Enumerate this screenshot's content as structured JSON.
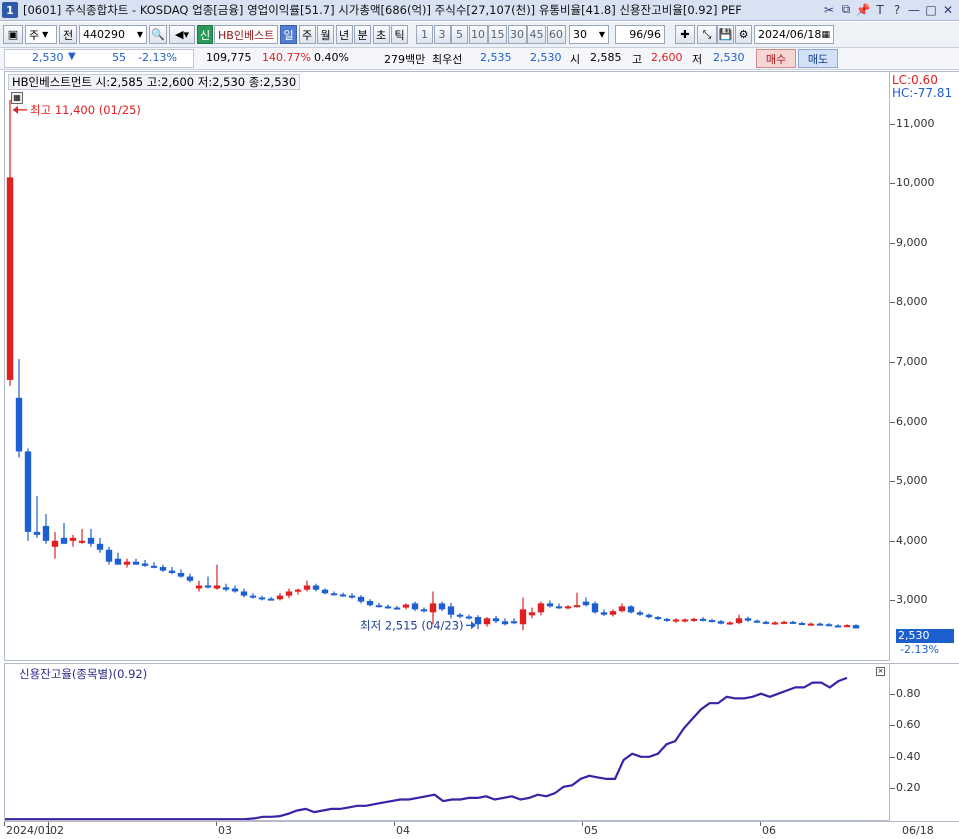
{
  "window": {
    "number": "1",
    "title": "[0601] 주식종합차트 - KOSDAQ 업종[금융] 영업이익률[51.7] 시가총액[686(억)] 주식수[27,107(천)] 유통비율[41.8] 신용잔고비율[0.92] PEF"
  },
  "toolbar": {
    "period_select": "주",
    "all_label": "전",
    "code": "440290",
    "credit_badge": "신",
    "stock_name": "HB인베스트",
    "period_tabs": [
      "일",
      "주",
      "월",
      "년",
      "분",
      "초",
      "틱"
    ],
    "active_tab": "일",
    "minute_options": [
      "1",
      "3",
      "5",
      "10",
      "15",
      "30",
      "45",
      "60"
    ],
    "minute_value": "30",
    "count": "96/96",
    "date": "2024/06/18"
  },
  "quote": {
    "price": "2,530",
    "direction": "▼",
    "change": "55",
    "change_pct": "-2.13%",
    "volume": "109,775",
    "volume_ratio": "140.77%",
    "turnover": "0.40%",
    "amount": "279백만",
    "best_label": "최우선",
    "best_ask": "2,535",
    "best_bid": "2,530",
    "open_label": "시",
    "open": "2,585",
    "high_label": "고",
    "high": "2,600",
    "low_label": "저",
    "low": "2,530",
    "buy_button": "매수",
    "sell_button": "매도"
  },
  "main_chart": {
    "legend": "HB인베스트먼트 시:2,585 고:2,600 저:2,530 종:2,530",
    "lc_label": "LC:0.60",
    "hc_label": "HC:-77.81",
    "high_annotation": "최고 11,400 (01/25)",
    "low_annotation": "최저 2,515 (04/23)",
    "current_price_tag": "2,530",
    "current_change_tag": "-2.13%",
    "y_ticks": [
      "11,000",
      "10,000",
      "9,000",
      "8,000",
      "7,000",
      "6,000",
      "5,000",
      "4,000",
      "3,000"
    ]
  },
  "sub_chart": {
    "legend": "신용잔고율(종목별)(0.92)",
    "y_ticks": [
      "0.80",
      "0.60",
      "0.40",
      "0.20"
    ]
  },
  "date_axis": {
    "labels": [
      "2024/01",
      "02",
      "03",
      "04",
      "05",
      "06"
    ],
    "end_label": "06/18"
  },
  "colors": {
    "up": "#e02020",
    "down": "#1e5fd0",
    "line": "#3a22a8",
    "active_tab": "#4f7ed1"
  },
  "chart_data": [
    {
      "type": "candlestick",
      "ylim": [
        2000,
        11700
      ],
      "candles": [
        {
          "o": 6700,
          "h": 11400,
          "l": 6600,
          "c": 10100
        },
        {
          "o": 6400,
          "h": 7050,
          "l": 5400,
          "c": 5500
        },
        {
          "o": 5500,
          "h": 5550,
          "l": 4000,
          "c": 4150
        },
        {
          "o": 4150,
          "h": 4750,
          "l": 4050,
          "c": 4100
        },
        {
          "o": 4250,
          "h": 4450,
          "l": 3950,
          "c": 4000
        },
        {
          "o": 3900,
          "h": 4150,
          "l": 3700,
          "c": 4000
        },
        {
          "o": 4050,
          "h": 4300,
          "l": 3950,
          "c": 3950
        },
        {
          "o": 4000,
          "h": 4100,
          "l": 3900,
          "c": 4050
        },
        {
          "o": 4000,
          "h": 4200,
          "l": 3950,
          "c": 4000
        },
        {
          "o": 4050,
          "h": 4200,
          "l": 3900,
          "c": 3950
        },
        {
          "o": 3950,
          "h": 4050,
          "l": 3800,
          "c": 3850
        },
        {
          "o": 3850,
          "h": 3900,
          "l": 3600,
          "c": 3650
        },
        {
          "o": 3700,
          "h": 3800,
          "l": 3600,
          "c": 3600
        },
        {
          "o": 3600,
          "h": 3700,
          "l": 3550,
          "c": 3650
        },
        {
          "o": 3650,
          "h": 3700,
          "l": 3600,
          "c": 3600
        },
        {
          "o": 3620,
          "h": 3680,
          "l": 3560,
          "c": 3580
        },
        {
          "o": 3580,
          "h": 3640,
          "l": 3540,
          "c": 3560
        },
        {
          "o": 3560,
          "h": 3600,
          "l": 3480,
          "c": 3500
        },
        {
          "o": 3500,
          "h": 3560,
          "l": 3440,
          "c": 3460
        },
        {
          "o": 3460,
          "h": 3520,
          "l": 3380,
          "c": 3400
        },
        {
          "o": 3400,
          "h": 3450,
          "l": 3300,
          "c": 3330
        },
        {
          "o": 3200,
          "h": 3330,
          "l": 3150,
          "c": 3250
        },
        {
          "o": 3250,
          "h": 3400,
          "l": 3200,
          "c": 3220
        },
        {
          "o": 3200,
          "h": 3600,
          "l": 3180,
          "c": 3250
        },
        {
          "o": 3220,
          "h": 3280,
          "l": 3150,
          "c": 3180
        },
        {
          "o": 3200,
          "h": 3250,
          "l": 3130,
          "c": 3150
        },
        {
          "o": 3150,
          "h": 3200,
          "l": 3050,
          "c": 3080
        },
        {
          "o": 3080,
          "h": 3120,
          "l": 3030,
          "c": 3050
        },
        {
          "o": 3050,
          "h": 3080,
          "l": 3000,
          "c": 3020
        },
        {
          "o": 3030,
          "h": 3060,
          "l": 3000,
          "c": 3010
        },
        {
          "o": 3020,
          "h": 3120,
          "l": 3000,
          "c": 3080
        },
        {
          "o": 3080,
          "h": 3200,
          "l": 3040,
          "c": 3150
        },
        {
          "o": 3150,
          "h": 3200,
          "l": 3100,
          "c": 3180
        },
        {
          "o": 3180,
          "h": 3330,
          "l": 3150,
          "c": 3250
        },
        {
          "o": 3250,
          "h": 3280,
          "l": 3150,
          "c": 3180
        },
        {
          "o": 3180,
          "h": 3200,
          "l": 3100,
          "c": 3120
        },
        {
          "o": 3120,
          "h": 3150,
          "l": 3080,
          "c": 3100
        },
        {
          "o": 3100,
          "h": 3130,
          "l": 3060,
          "c": 3080
        },
        {
          "o": 3080,
          "h": 3120,
          "l": 3030,
          "c": 3050
        },
        {
          "o": 3060,
          "h": 3090,
          "l": 2950,
          "c": 2980
        },
        {
          "o": 2990,
          "h": 3020,
          "l": 2900,
          "c": 2920
        },
        {
          "o": 2920,
          "h": 2960,
          "l": 2880,
          "c": 2900
        },
        {
          "o": 2900,
          "h": 2930,
          "l": 2860,
          "c": 2880
        },
        {
          "o": 2880,
          "h": 2910,
          "l": 2850,
          "c": 2870
        },
        {
          "o": 2880,
          "h": 2950,
          "l": 2850,
          "c": 2930
        },
        {
          "o": 2950,
          "h": 2980,
          "l": 2820,
          "c": 2850
        },
        {
          "o": 2850,
          "h": 2880,
          "l": 2800,
          "c": 2820
        },
        {
          "o": 2800,
          "h": 3150,
          "l": 2600,
          "c": 2950
        },
        {
          "o": 2950,
          "h": 2980,
          "l": 2820,
          "c": 2850
        },
        {
          "o": 2900,
          "h": 2960,
          "l": 2700,
          "c": 2760
        },
        {
          "o": 2760,
          "h": 2790,
          "l": 2700,
          "c": 2730
        },
        {
          "o": 2730,
          "h": 2760,
          "l": 2680,
          "c": 2700
        },
        {
          "o": 2720,
          "h": 2750,
          "l": 2515,
          "c": 2600
        },
        {
          "o": 2600,
          "h": 2720,
          "l": 2560,
          "c": 2700
        },
        {
          "o": 2700,
          "h": 2740,
          "l": 2620,
          "c": 2650
        },
        {
          "o": 2650,
          "h": 2700,
          "l": 2580,
          "c": 2600
        },
        {
          "o": 2650,
          "h": 2700,
          "l": 2600,
          "c": 2620
        },
        {
          "o": 2600,
          "h": 3050,
          "l": 2500,
          "c": 2850
        },
        {
          "o": 2750,
          "h": 2880,
          "l": 2700,
          "c": 2800
        },
        {
          "o": 2800,
          "h": 2980,
          "l": 2750,
          "c": 2950
        },
        {
          "o": 2950,
          "h": 3000,
          "l": 2880,
          "c": 2900
        },
        {
          "o": 2900,
          "h": 2950,
          "l": 2860,
          "c": 2880
        },
        {
          "o": 2880,
          "h": 2920,
          "l": 2850,
          "c": 2900
        },
        {
          "o": 2900,
          "h": 3130,
          "l": 2880,
          "c": 2920
        },
        {
          "o": 2980,
          "h": 3050,
          "l": 2900,
          "c": 2920
        },
        {
          "o": 2950,
          "h": 2980,
          "l": 2780,
          "c": 2800
        },
        {
          "o": 2800,
          "h": 2850,
          "l": 2740,
          "c": 2760
        },
        {
          "o": 2760,
          "h": 2850,
          "l": 2730,
          "c": 2820
        },
        {
          "o": 2820,
          "h": 2950,
          "l": 2800,
          "c": 2900
        },
        {
          "o": 2900,
          "h": 2920,
          "l": 2780,
          "c": 2800
        },
        {
          "o": 2800,
          "h": 2830,
          "l": 2740,
          "c": 2760
        },
        {
          "o": 2760,
          "h": 2780,
          "l": 2700,
          "c": 2720
        },
        {
          "o": 2720,
          "h": 2740,
          "l": 2670,
          "c": 2690
        },
        {
          "o": 2690,
          "h": 2710,
          "l": 2640,
          "c": 2660
        },
        {
          "o": 2650,
          "h": 2700,
          "l": 2620,
          "c": 2680
        },
        {
          "o": 2660,
          "h": 2700,
          "l": 2630,
          "c": 2680
        },
        {
          "o": 2670,
          "h": 2710,
          "l": 2640,
          "c": 2690
        },
        {
          "o": 2690,
          "h": 2720,
          "l": 2650,
          "c": 2670
        },
        {
          "o": 2670,
          "h": 2690,
          "l": 2630,
          "c": 2650
        },
        {
          "o": 2650,
          "h": 2670,
          "l": 2600,
          "c": 2610
        },
        {
          "o": 2610,
          "h": 2650,
          "l": 2590,
          "c": 2630
        },
        {
          "o": 2620,
          "h": 2760,
          "l": 2600,
          "c": 2700
        },
        {
          "o": 2700,
          "h": 2730,
          "l": 2640,
          "c": 2660
        },
        {
          "o": 2660,
          "h": 2680,
          "l": 2620,
          "c": 2640
        },
        {
          "o": 2640,
          "h": 2660,
          "l": 2600,
          "c": 2620
        },
        {
          "o": 2610,
          "h": 2650,
          "l": 2590,
          "c": 2630
        },
        {
          "o": 2620,
          "h": 2660,
          "l": 2600,
          "c": 2640
        },
        {
          "o": 2640,
          "h": 2660,
          "l": 2610,
          "c": 2620
        },
        {
          "o": 2620,
          "h": 2640,
          "l": 2590,
          "c": 2600
        },
        {
          "o": 2600,
          "h": 2630,
          "l": 2580,
          "c": 2610
        },
        {
          "o": 2610,
          "h": 2630,
          "l": 2590,
          "c": 2600
        },
        {
          "o": 2600,
          "h": 2620,
          "l": 2570,
          "c": 2580
        },
        {
          "o": 2580,
          "h": 2600,
          "l": 2560,
          "c": 2570
        },
        {
          "o": 2570,
          "h": 2600,
          "l": 2550,
          "c": 2585
        },
        {
          "o": 2585,
          "h": 2600,
          "l": 2530,
          "c": 2530
        }
      ]
    },
    {
      "type": "line",
      "ylim": [
        0,
        0.95
      ],
      "series": [
        {
          "values": [
            0.005,
            0.005,
            0.005,
            0.005,
            0.005,
            0.005,
            0.005,
            0.005,
            0.005,
            0.005,
            0.005,
            0.005,
            0.005,
            0.005,
            0.005,
            0.005,
            0.005,
            0.005,
            0.005,
            0.005,
            0.005,
            0.005,
            0.005,
            0.005,
            0.005,
            0.005,
            0.005,
            0.005,
            0.006,
            0.01,
            0.02,
            0.02,
            0.025,
            0.04,
            0.06,
            0.07,
            0.05,
            0.06,
            0.07,
            0.07,
            0.08,
            0.09,
            0.09,
            0.1,
            0.11,
            0.12,
            0.13,
            0.13,
            0.14,
            0.15,
            0.16,
            0.12,
            0.13,
            0.13,
            0.14,
            0.14,
            0.15,
            0.13,
            0.14,
            0.15,
            0.13,
            0.14,
            0.16,
            0.15,
            0.17,
            0.21,
            0.22,
            0.26,
            0.28,
            0.27,
            0.26,
            0.26,
            0.38,
            0.42,
            0.4,
            0.4,
            0.42,
            0.48,
            0.5,
            0.58,
            0.64,
            0.7,
            0.74,
            0.74,
            0.78,
            0.77,
            0.77,
            0.78,
            0.8,
            0.78,
            0.8,
            0.82,
            0.84,
            0.84,
            0.87,
            0.87,
            0.84,
            0.88,
            0.9
          ]
        }
      ]
    }
  ]
}
